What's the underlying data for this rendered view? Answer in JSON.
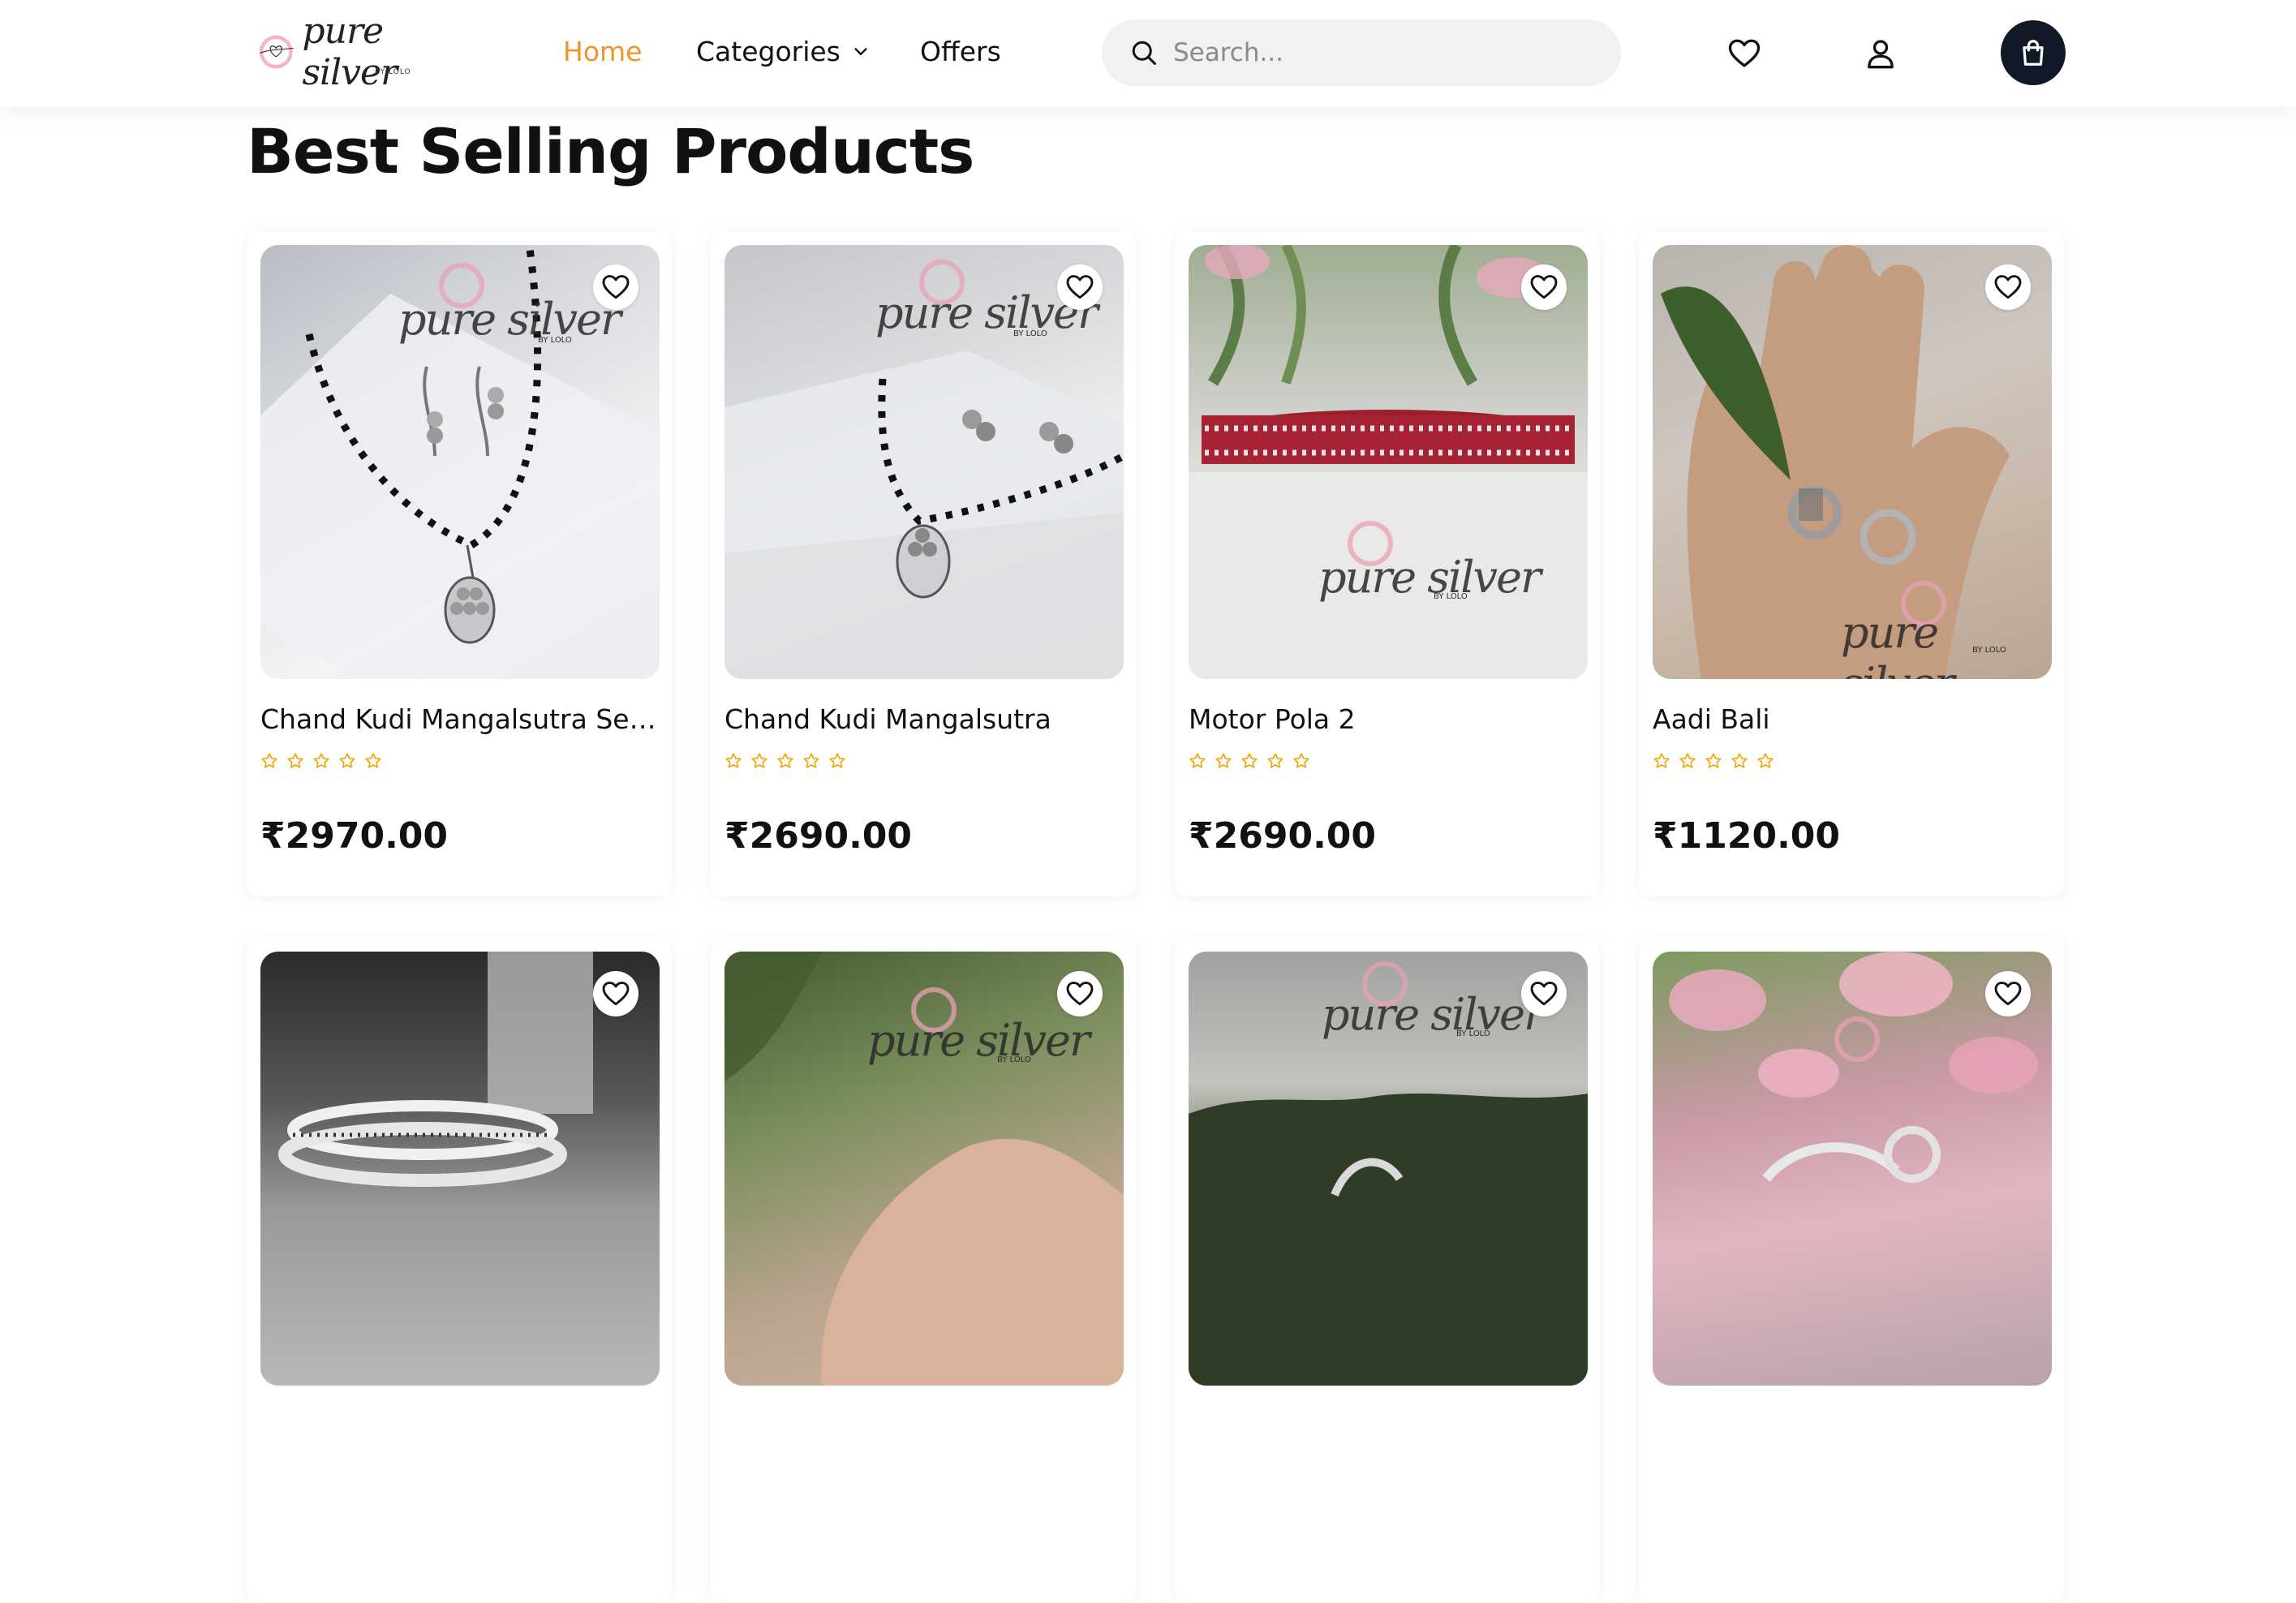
{
  "header": {
    "logo": {
      "word": "pure silver",
      "sub": "BY LOLO"
    },
    "nav": {
      "home": "Home",
      "categories": "Categories",
      "offers": "Offers"
    },
    "search": {
      "placeholder": "Search..."
    },
    "icons": {
      "wishlist": "heart-icon",
      "account": "user-icon",
      "cart": "bag-icon"
    },
    "colors": {
      "accent": "#f0932b",
      "cart_bg": "#111827"
    }
  },
  "section": {
    "title": "Best Selling Products"
  },
  "products": [
    {
      "name": "Chand Kudi Mangalsutra Set (Wi...",
      "rating": 0,
      "price": "₹2970.00"
    },
    {
      "name": "Chand Kudi Mangalsutra",
      "rating": 0,
      "price": "₹2690.00"
    },
    {
      "name": "Motor Pola 2",
      "rating": 0,
      "price": "₹2690.00"
    },
    {
      "name": "Aadi Bali",
      "rating": 0,
      "price": "₹1120.00"
    }
  ],
  "watermark": {
    "word": "pure silver",
    "sub": "BY LOLO"
  },
  "star_color": "#f0a500"
}
